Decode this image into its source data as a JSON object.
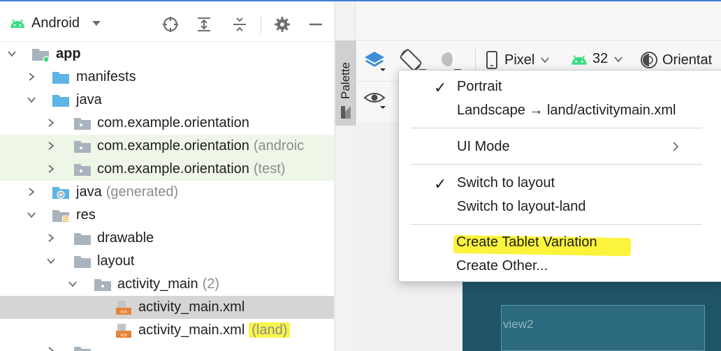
{
  "project_panel": {
    "view_selector": "Android",
    "tree": [
      {
        "label": "app",
        "bold": true,
        "suffix": "",
        "expanded": true
      },
      {
        "label": "manifests",
        "suffix": ""
      },
      {
        "label": "java",
        "suffix": "",
        "expanded": true
      },
      {
        "label": "com.example.orientation",
        "suffix": ""
      },
      {
        "label": "com.example.orientation",
        "suffix": "(androic"
      },
      {
        "label": "com.example.orientation",
        "suffix": "(test)"
      },
      {
        "label": "java",
        "suffix": "(generated)"
      },
      {
        "label": "res",
        "suffix": "",
        "expanded": true
      },
      {
        "label": "drawable",
        "suffix": ""
      },
      {
        "label": "layout",
        "suffix": "",
        "expanded": true
      },
      {
        "label": "activity_main",
        "suffix": "(2)",
        "expanded": true
      },
      {
        "label": "activity_main.xml",
        "suffix": "",
        "selected": true
      },
      {
        "label": "activity_main.xml",
        "suffix": "(land)",
        "highlighted": true
      }
    ]
  },
  "palette": {
    "label": "Palette"
  },
  "toolbar": {
    "device": "Pixel",
    "api_level": "32",
    "orientation": "Orientat"
  },
  "canvas": {
    "view_label": "view2"
  },
  "menu": {
    "items": [
      {
        "label": "Portrait",
        "checked": true
      },
      {
        "label": "Landscape → land/activitymain.xml",
        "checked": false
      },
      {
        "label": "UI Mode",
        "submenu": true
      },
      {
        "label": "Switch to layout",
        "checked": true
      },
      {
        "label": "Switch to layout-land",
        "checked": false
      },
      {
        "label": "Create Tablet Variation",
        "highlighted": true
      },
      {
        "label": "Create Other..."
      }
    ],
    "check_glyph": "✓"
  },
  "colors": {
    "android_green": "#3ddc84",
    "folder_blue": "#5fb4e6",
    "folder_gray": "#a9b3bd",
    "highlight_yellow": "#f7f44a",
    "device_teal": "#1f5468",
    "accent_blue": "#3d7fd9"
  }
}
